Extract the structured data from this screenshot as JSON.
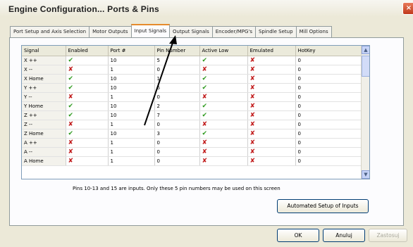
{
  "window": {
    "title": "Engine Configuration... Ports & Pins",
    "close": "×"
  },
  "tabs": [
    {
      "label": "Port Setup and Axis Selection",
      "active": false
    },
    {
      "label": "Motor Outputs",
      "active": false
    },
    {
      "label": "Input Signals",
      "active": true
    },
    {
      "label": "Output Signals",
      "active": false
    },
    {
      "label": "Encoder/MPG's",
      "active": false
    },
    {
      "label": "Spindle Setup",
      "active": false
    },
    {
      "label": "Mill Options",
      "active": false
    }
  ],
  "table": {
    "columns": [
      "Signal",
      "Enabled",
      "Port #",
      "Pin Number",
      "Active Low",
      "Emulated",
      "HotKey"
    ],
    "check_symbol": "✔",
    "cross_symbol": "✘",
    "rows": [
      {
        "signal": "X ++",
        "enabled": true,
        "port": "10",
        "pin": "5",
        "active_low": true,
        "emulated": false,
        "hotkey": "0"
      },
      {
        "signal": "X --",
        "enabled": false,
        "port": "1",
        "pin": "0",
        "active_low": false,
        "emulated": false,
        "hotkey": "0"
      },
      {
        "signal": "X Home",
        "enabled": true,
        "port": "10",
        "pin": "1",
        "active_low": true,
        "emulated": false,
        "hotkey": "0"
      },
      {
        "signal": "Y ++",
        "enabled": true,
        "port": "10",
        "pin": "6",
        "active_low": true,
        "emulated": false,
        "hotkey": "0"
      },
      {
        "signal": "Y --",
        "enabled": false,
        "port": "1",
        "pin": "0",
        "active_low": false,
        "emulated": false,
        "hotkey": "0"
      },
      {
        "signal": "Y Home",
        "enabled": true,
        "port": "10",
        "pin": "2",
        "active_low": true,
        "emulated": false,
        "hotkey": "0"
      },
      {
        "signal": "Z ++",
        "enabled": true,
        "port": "10",
        "pin": "7",
        "active_low": true,
        "emulated": false,
        "hotkey": "0"
      },
      {
        "signal": "Z --",
        "enabled": false,
        "port": "1",
        "pin": "0",
        "active_low": false,
        "emulated": false,
        "hotkey": "0"
      },
      {
        "signal": "Z Home",
        "enabled": true,
        "port": "10",
        "pin": "3",
        "active_low": true,
        "emulated": false,
        "hotkey": "0"
      },
      {
        "signal": "A ++",
        "enabled": false,
        "port": "1",
        "pin": "0",
        "active_low": false,
        "emulated": false,
        "hotkey": "0"
      },
      {
        "signal": "A --",
        "enabled": false,
        "port": "1",
        "pin": "0",
        "active_low": false,
        "emulated": false,
        "hotkey": "0"
      },
      {
        "signal": "A Home",
        "enabled": false,
        "port": "1",
        "pin": "0",
        "active_low": false,
        "emulated": false,
        "hotkey": "0"
      }
    ]
  },
  "scrollbar": {
    "up": "▲",
    "down": "▼"
  },
  "note": "Pins 10-13 and 15 are inputs. Only these 5 pin numbers may be used on this screen",
  "buttons": {
    "automated_setup": "Automated Setup of Inputs",
    "ok": "OK",
    "cancel": "Anuluj",
    "apply": "Zastosuj"
  },
  "colors": {
    "check": "#2e9a1e",
    "cross": "#c11b1b",
    "active_tab_accent": "#e68b2c"
  }
}
